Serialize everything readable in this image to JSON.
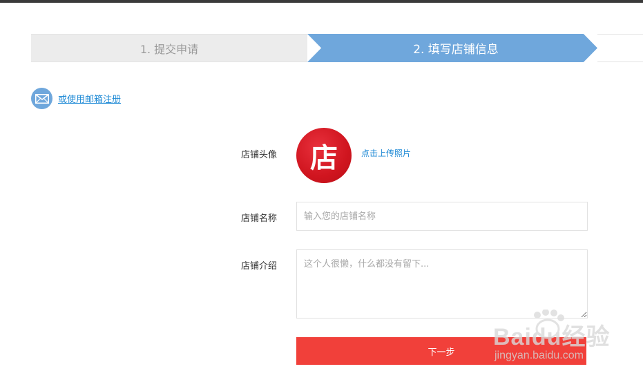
{
  "stepper": {
    "steps": [
      {
        "label": "1. 提交申请",
        "state": "done"
      },
      {
        "label": "2. 填写店铺信息",
        "state": "active"
      },
      {
        "label": "",
        "state": "pending"
      }
    ],
    "active_color": "#6fa7dc",
    "inactive_color": "#ececec"
  },
  "email_register": {
    "label": "或使用邮箱注册",
    "icon": "envelope-icon"
  },
  "form": {
    "avatar": {
      "label": "店铺头像",
      "glyph": "店",
      "upload_link": "点击上传照片"
    },
    "shop_name": {
      "label": "店铺名称",
      "placeholder": "输入您的店铺名称",
      "value": ""
    },
    "shop_intro": {
      "label": "店铺介绍",
      "placeholder": "这个人很懒，什么都没有留下...",
      "value": ""
    },
    "next_button": {
      "label": "下一步",
      "color": "#f1403a"
    }
  },
  "watermark": {
    "logo": "Baidu经验",
    "url": "jingyan.baidu.com"
  }
}
